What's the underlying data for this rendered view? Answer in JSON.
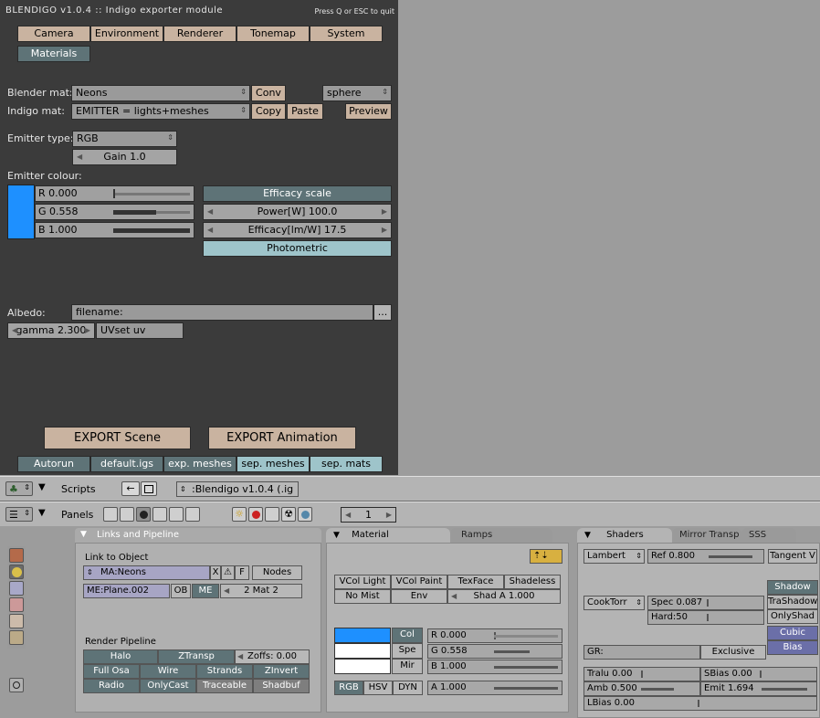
{
  "header": {
    "title": "BLENDIGO v1.0.4  ::  Indigo exporter module",
    "quit_hint": "Press Q or ESC to quit"
  },
  "tabs": [
    "Camera",
    "Environment",
    "Renderer",
    "Tonemap",
    "System"
  ],
  "active_tab": "Materials",
  "materials": {
    "blender_mat_label": "Blender mat:",
    "blender_mat_value": "Neons",
    "conv_label": "Conv",
    "preview_shape": "sphere",
    "indigo_mat_label": "Indigo mat:",
    "indigo_mat_value": "EMITTER = lights+meshes",
    "copy_label": "Copy",
    "paste_label": "Paste",
    "preview_label": "Preview"
  },
  "emitter": {
    "type_label": "Emitter type:",
    "type_value": "RGB",
    "gain": "Gain 1.0",
    "colour_label": "Emitter colour:",
    "r": "R 0.000",
    "g": "G 0.558",
    "b": "B 1.000",
    "swatch": "#1e90ff",
    "efficacy_scale": "Efficacy scale",
    "power": "Power[W] 100.0",
    "efficacy": "Efficacy[lm/W] 17.5",
    "photometric": "Photometric"
  },
  "albedo": {
    "label": "Albedo:",
    "filename": "filename:",
    "browse": "...",
    "gamma": "gamma 2.300",
    "uvset": "UVset uv"
  },
  "export": {
    "scene": "EXPORT Scene",
    "animation": "EXPORT Animation",
    "toggles": [
      "Autorun",
      "default.igs",
      "exp. meshes",
      "sep. meshes",
      "sep. mats"
    ]
  },
  "scripts_header": {
    "label": "Scripts",
    "script_name": ":Blendigo v1.0.4 (.ig"
  },
  "buttons_header": {
    "label": "Panels",
    "frame": "1"
  },
  "link_pipeline": {
    "title": "Links and Pipeline",
    "link_to_object": "Link to Object",
    "ma_name": "MA:Neons",
    "x": "X",
    "f": "F",
    "nodes": "Nodes",
    "me_name": "ME:Plane.002",
    "ob": "OB",
    "me": "ME",
    "mat_count": "2 Mat 2",
    "render_pipeline": "Render Pipeline",
    "row1": [
      "Halo",
      "ZTransp",
      "Zoffs: 0.00"
    ],
    "row2": [
      "Full Osa",
      "Wire",
      "Strands",
      "ZInvert"
    ],
    "row3": [
      "Radio",
      "OnlyCast",
      "Traceable",
      "Shadbuf"
    ]
  },
  "material_panel": {
    "tab_active": "Material",
    "tab_other": "Ramps",
    "row1": [
      "VCol Light",
      "VCol Paint",
      "TexFace",
      "Shadeless"
    ],
    "row2": [
      "No Mist",
      "Env",
      "Shad A 1.000"
    ],
    "col": "Col",
    "spe": "Spe",
    "mir": "Mir",
    "r": "R 0.000",
    "g": "G 0.558",
    "b": "B 1.000",
    "a": "A 1.000",
    "modes": [
      "RGB",
      "HSV",
      "DYN"
    ],
    "swatch": "#1e90ff"
  },
  "shaders_panel": {
    "tab_active": "Shaders",
    "tab_other": "Mirror Transp",
    "tab_other2": "SSS",
    "diffuse": "Lambert",
    "ref": "Ref   0.800",
    "tangent": "Tangent V",
    "shadow_col": [
      "Shadow",
      "TraShadow",
      "OnlyShad",
      "Cubic",
      "Bias"
    ],
    "specular": "CookTorr",
    "spec": "Spec 0.087",
    "hard": "Hard:50",
    "gr": "GR:",
    "exclusive": "Exclusive",
    "tralu": "Tralu 0.00",
    "sbias": "SBias 0.00",
    "amb": "Amb 0.500",
    "emit": "Emit 1.694",
    "lbias": "LBias 0.00"
  }
}
